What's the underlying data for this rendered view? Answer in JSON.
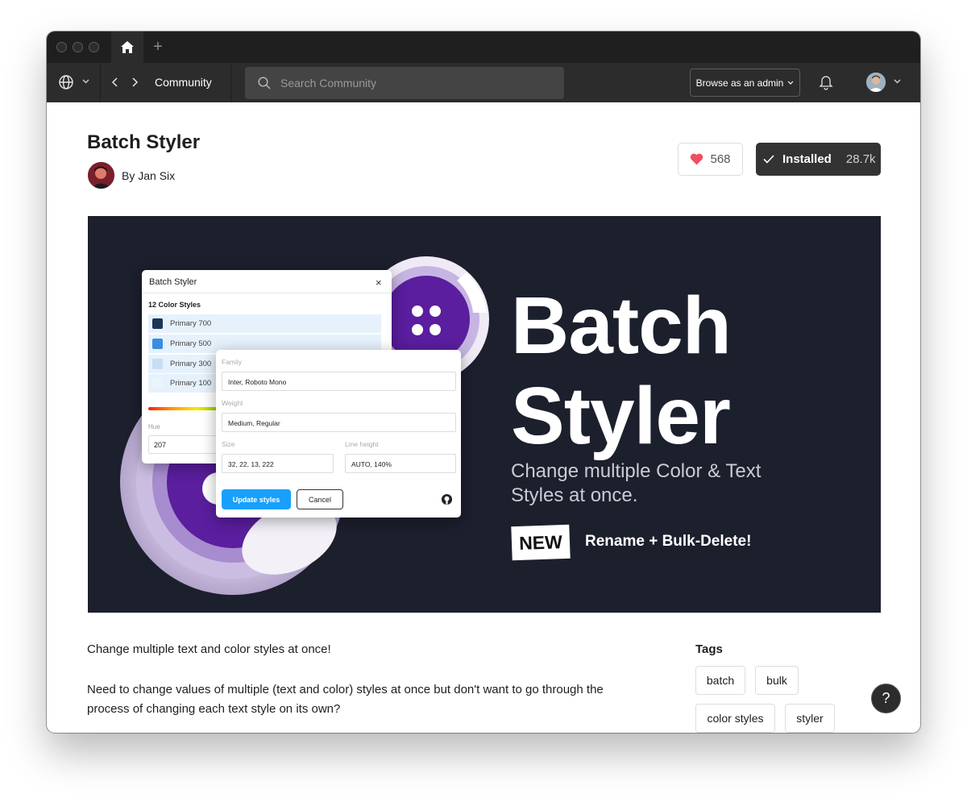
{
  "nav": {
    "breadcrumb": "Community",
    "search_placeholder": "Search Community",
    "browse_admin_label": "Browse as an admin"
  },
  "plugin": {
    "title": "Batch Styler",
    "author": "By Jan Six",
    "likes": "568",
    "install_label": "Installed",
    "install_count": "28.7k"
  },
  "hero": {
    "title_line1": "Batch",
    "title_line2": "Styler",
    "subtitle": "Change multiple Color & Text Styles at once.",
    "badge": "NEW",
    "feature": "Rename + Bulk-Delete!",
    "panel": {
      "title": "Batch Styler",
      "close": "×",
      "count": "12 Color Styles",
      "styles": [
        {
          "label": "Primary 700",
          "color": "#1d3557"
        },
        {
          "label": "Primary 500",
          "color": "#3a8ee0"
        },
        {
          "label": "Primary 300",
          "color": "#c6ddf4"
        },
        {
          "label": "Primary 100",
          "color": "#eaf4fd"
        }
      ],
      "hue_label": "Hue",
      "hue_value": "207"
    },
    "editor": {
      "family_label": "Family",
      "family_value": "Inter, Roboto Mono",
      "weight_label": "Weight",
      "weight_value": "Medium, Regular",
      "size_label": "Size",
      "size_value": "32, 22, 13, 222",
      "line_height_label": "Line height",
      "line_height_value": "AUTO, 140%",
      "update_label": "Update styles",
      "cancel_label": "Cancel"
    }
  },
  "description": {
    "line1": "Change multiple text and color styles at once!",
    "line2": "Need to change values of multiple (text and color) styles at once but don't want to go through the process of changing each text style on its own?"
  },
  "tags": {
    "title": "Tags",
    "items": [
      "batch",
      "bulk",
      "color styles",
      "styler"
    ]
  },
  "help": "?",
  "colors": {
    "accent_blue": "#18a0fb",
    "heart": "#f24e63",
    "hero_bg": "#1c1f2c",
    "toolbar": "#2c2c2c"
  }
}
